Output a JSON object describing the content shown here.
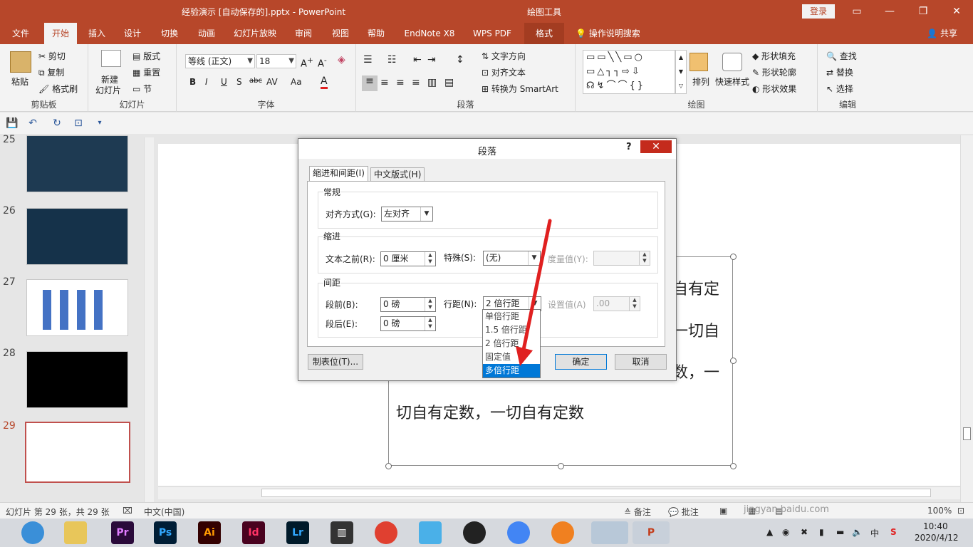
{
  "titlebar": {
    "title": "经验演示 [自动保存的].pptx  -  PowerPoint",
    "tools_label": "绘图工具",
    "login": "登录",
    "icons": [
      "ribbon-display-icon",
      "minimize-icon",
      "restore-icon",
      "close-icon"
    ]
  },
  "tabs": [
    "文件",
    "开始",
    "插入",
    "设计",
    "切换",
    "动画",
    "幻灯片放映",
    "审阅",
    "视图",
    "帮助",
    "EndNote X8",
    "WPS PDF",
    "格式"
  ],
  "active_tab": "开始",
  "search": "操作说明搜索",
  "share": "共享",
  "ribbon": {
    "clipboard": {
      "paste": "粘贴",
      "cut": "剪切",
      "copy": "复制",
      "format_painter": "格式刷",
      "label": "剪贴板"
    },
    "slides": {
      "new_slide": "新建",
      "new_slide2": "幻灯片",
      "layout": "版式",
      "reset": "重置",
      "section": "节",
      "label": "幻灯片"
    },
    "font": {
      "font_name": "等线 (正文)",
      "font_size": "18",
      "label": "字体",
      "bold": "B",
      "italic": "I",
      "underline": "U",
      "shadow": "S",
      "strike": "abc",
      "spacing": "AV",
      "case": "Aa",
      "color": "A"
    },
    "paragraph": {
      "text_direction": "文字方向",
      "align_text": "对齐文本",
      "smartart": "转换为 SmartArt",
      "label": "段落"
    },
    "drawing": {
      "arrange": "排列",
      "quick_styles": "快速样式",
      "shape_fill": "形状填充",
      "shape_outline": "形状轮廓",
      "shape_effects": "形状效果",
      "label": "绘图"
    },
    "editing": {
      "find": "查找",
      "replace": "替换",
      "select": "选择",
      "label": "编辑"
    }
  },
  "thumbnails": [
    {
      "num": "25",
      "bg": "#1e3a52"
    },
    {
      "num": "26",
      "bg": "#15324a"
    },
    {
      "num": "27",
      "bg": "#ffffff"
    },
    {
      "num": "28",
      "bg": "#000000"
    },
    {
      "num": "29",
      "bg": "#ffffff"
    }
  ],
  "slide": {
    "lines": [
      "自有定",
      "一切自",
      "数，一",
      "切自有定数，一切自有定数"
    ]
  },
  "dialog": {
    "title": "段落",
    "help": "?",
    "tab_indent": "缩进和间距(I)",
    "tab_chinese": "中文版式(H)",
    "general": {
      "legend": "常规",
      "align_label": "对齐方式(G):",
      "align_value": "左对齐"
    },
    "indent": {
      "legend": "缩进",
      "before_label": "文本之前(R):",
      "before_value": "0 厘米",
      "special_label": "特殊(S):",
      "special_value": "(无)",
      "by_label": "度量值(Y):",
      "by_value": ""
    },
    "spacing": {
      "legend": "间距",
      "before_label": "段前(B):",
      "before_value": "0 磅",
      "after_label": "段后(E):",
      "after_value": "0 磅",
      "line_label": "行距(N):",
      "line_value": "2 倍行距",
      "at_label": "设置值(A)",
      "at_value": ".00"
    },
    "dropdown_options": [
      "单倍行距",
      "1.5 倍行距",
      "2 倍行距",
      "固定值",
      "多倍行距"
    ],
    "selected_option": "多倍行距",
    "tabs_button": "制表位(T)...",
    "ok": "确定",
    "cancel": "取消"
  },
  "status": {
    "slide_count": "幻灯片 第 29 张，共 29 张",
    "language": "中文(中国)",
    "notes": "备注",
    "comments": "批注",
    "zoom": "100%",
    "watermark": "jingyan.baidu.com"
  },
  "taskbar": {
    "apps": [
      "Pr",
      "Ps",
      "Ai",
      "Id",
      "Lr"
    ],
    "time": "10:40",
    "date": "2020/4/12",
    "ime": "中"
  },
  "colors": {
    "accent": "#b7472a",
    "selection": "#0078d7",
    "arrow": "#e02020"
  }
}
